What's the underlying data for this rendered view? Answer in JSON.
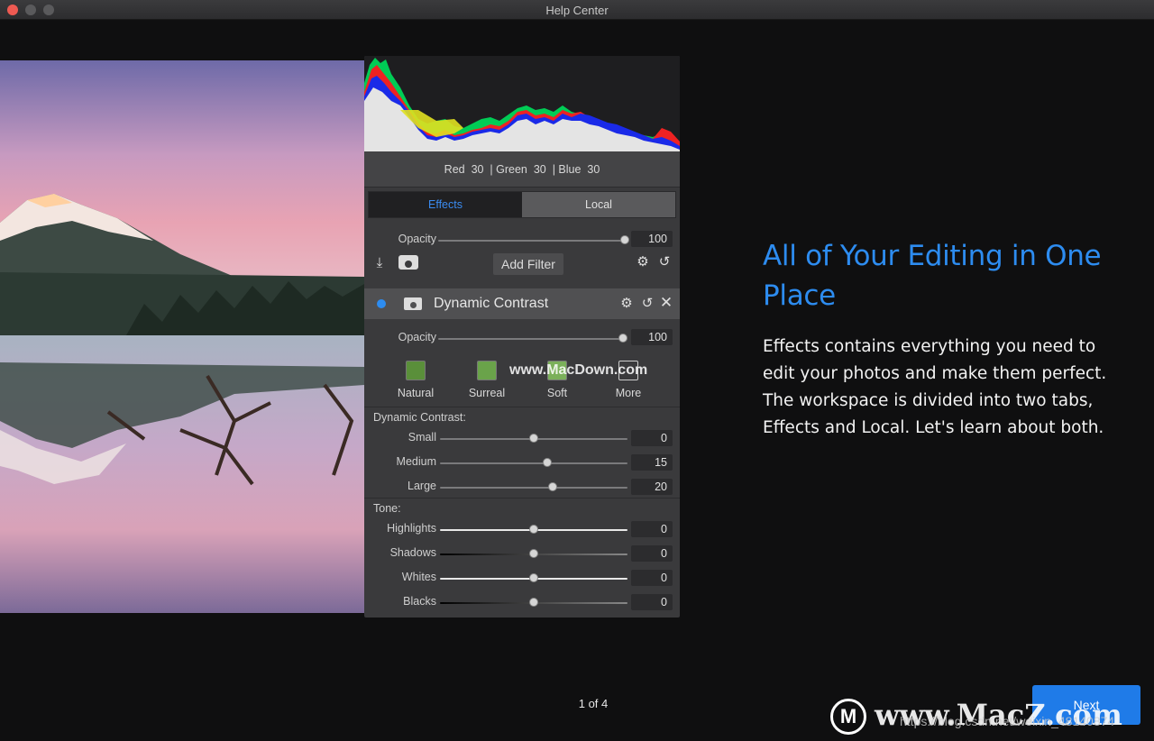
{
  "window": {
    "title": "Help Center"
  },
  "histogram": {
    "red_label": "Red",
    "red": "30",
    "green_label": "| Green",
    "green": "30",
    "blue_label": "| Blue",
    "blue": "30"
  },
  "tabs": [
    {
      "label": "Effects",
      "active": true
    },
    {
      "label": "Local",
      "active": false
    }
  ],
  "layer": {
    "opacity_label": "Opacity",
    "opacity": "100",
    "opacity_level": 1.0,
    "add_filter": "Add Filter"
  },
  "filter": {
    "name": "Dynamic Contrast",
    "opacity_label": "Opacity",
    "opacity": "100",
    "presets": [
      {
        "label": "Natural"
      },
      {
        "label": "Surreal"
      },
      {
        "label": "Soft"
      },
      {
        "label": "More"
      }
    ],
    "dc_section": "Dynamic Contrast:",
    "dc_sliders": [
      {
        "label": "Small",
        "value": "0",
        "level": 0.5
      },
      {
        "label": "Medium",
        "value": "15",
        "level": 0.57
      },
      {
        "label": "Large",
        "value": "20",
        "level": 0.6
      }
    ],
    "tone_section": "Tone:",
    "tone_sliders": [
      {
        "label": "Highlights",
        "value": "0",
        "level": 0.5
      },
      {
        "label": "Shadows",
        "value": "0",
        "level": 0.5
      },
      {
        "label": "Whites",
        "value": "0",
        "level": 0.5
      },
      {
        "label": "Blacks",
        "value": "0",
        "level": 0.5
      }
    ]
  },
  "intro": {
    "heading": "All of Your Editing in One Place",
    "body": "Effects contains everything you need to edit your photos and make them perfect. The workspace is divided into two tabs, Effects and Local. Let's learn about both."
  },
  "pager": "1 of 4",
  "next_label": "Next",
  "watermarks": {
    "mid": "www.MacDown.com",
    "bottom": "www.MacZ.com",
    "url": "https://blog.csdn.net/weixin_48140874"
  },
  "colors": {
    "accent": "#2d8cf0",
    "next_button": "#1f7be8",
    "close": "#ee5a52"
  }
}
